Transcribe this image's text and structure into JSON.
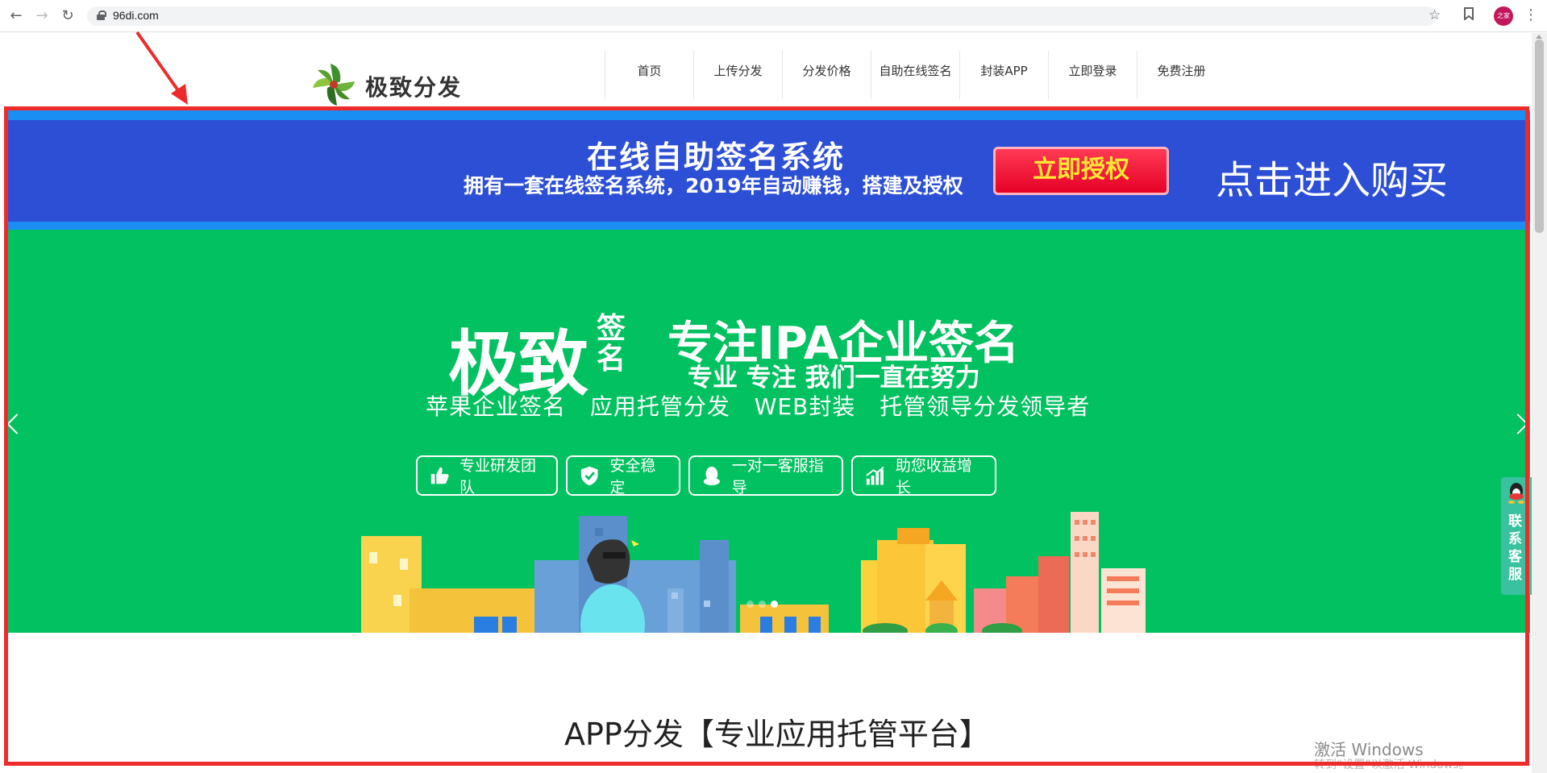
{
  "browser": {
    "url": "96di.com",
    "back_icon": "arrow-left-icon",
    "forward_icon": "arrow-right-icon",
    "reload_icon": "reload-icon",
    "lock_icon": "lock-icon",
    "bookmark_star_icon": "star-icon",
    "avatar_text": "之家"
  },
  "site": {
    "logo_text": "极致分发",
    "nav": [
      {
        "label": "首页"
      },
      {
        "label": "上传分发"
      },
      {
        "label": "分发价格"
      },
      {
        "label": "自助在线签名"
      },
      {
        "label": "封装APP"
      },
      {
        "label": "立即登录"
      },
      {
        "label": "免费注册"
      }
    ]
  },
  "banner": {
    "title": "在线自助签名系统",
    "subtitle": "拥有一套在线签名系统，2019年自动赚钱，搭建及授权",
    "button": "立即授权",
    "buy_text": "点击进入购买",
    "colors": {
      "bg": "#2d4fd6",
      "stripe": "#1a8ef2",
      "button": "#e60026",
      "button_text": "#ffe835"
    }
  },
  "hero": {
    "brand": "极致",
    "brand_suffix_1": "签",
    "brand_suffix_2": "名",
    "focus": "专注IPA企业签名",
    "slogan": "专业 专注 我们一直在努力",
    "services": "苹果企业签名 应用托管分发 WEB封装 托管领导分发领导者",
    "features": [
      {
        "icon": "thumbs-up-icon",
        "label": "专业研发团队"
      },
      {
        "icon": "shield-check-icon",
        "label": "安全稳定"
      },
      {
        "icon": "qq-penguin-icon",
        "label": "一对一客服指导"
      },
      {
        "icon": "growth-chart-icon",
        "label": "助您收益增长"
      }
    ],
    "carousel_active": 3,
    "carousel_total": 3,
    "colors": {
      "bg": "#02c160"
    }
  },
  "service_widget": {
    "label": "联系客服"
  },
  "section": {
    "title": "APP分发【专业应用托管平台】"
  },
  "watermark": {
    "line1": "激活 Windows",
    "line2": "转到“设置”以激活 Windows。"
  },
  "annotation": {
    "color": "#ee2b2b"
  }
}
